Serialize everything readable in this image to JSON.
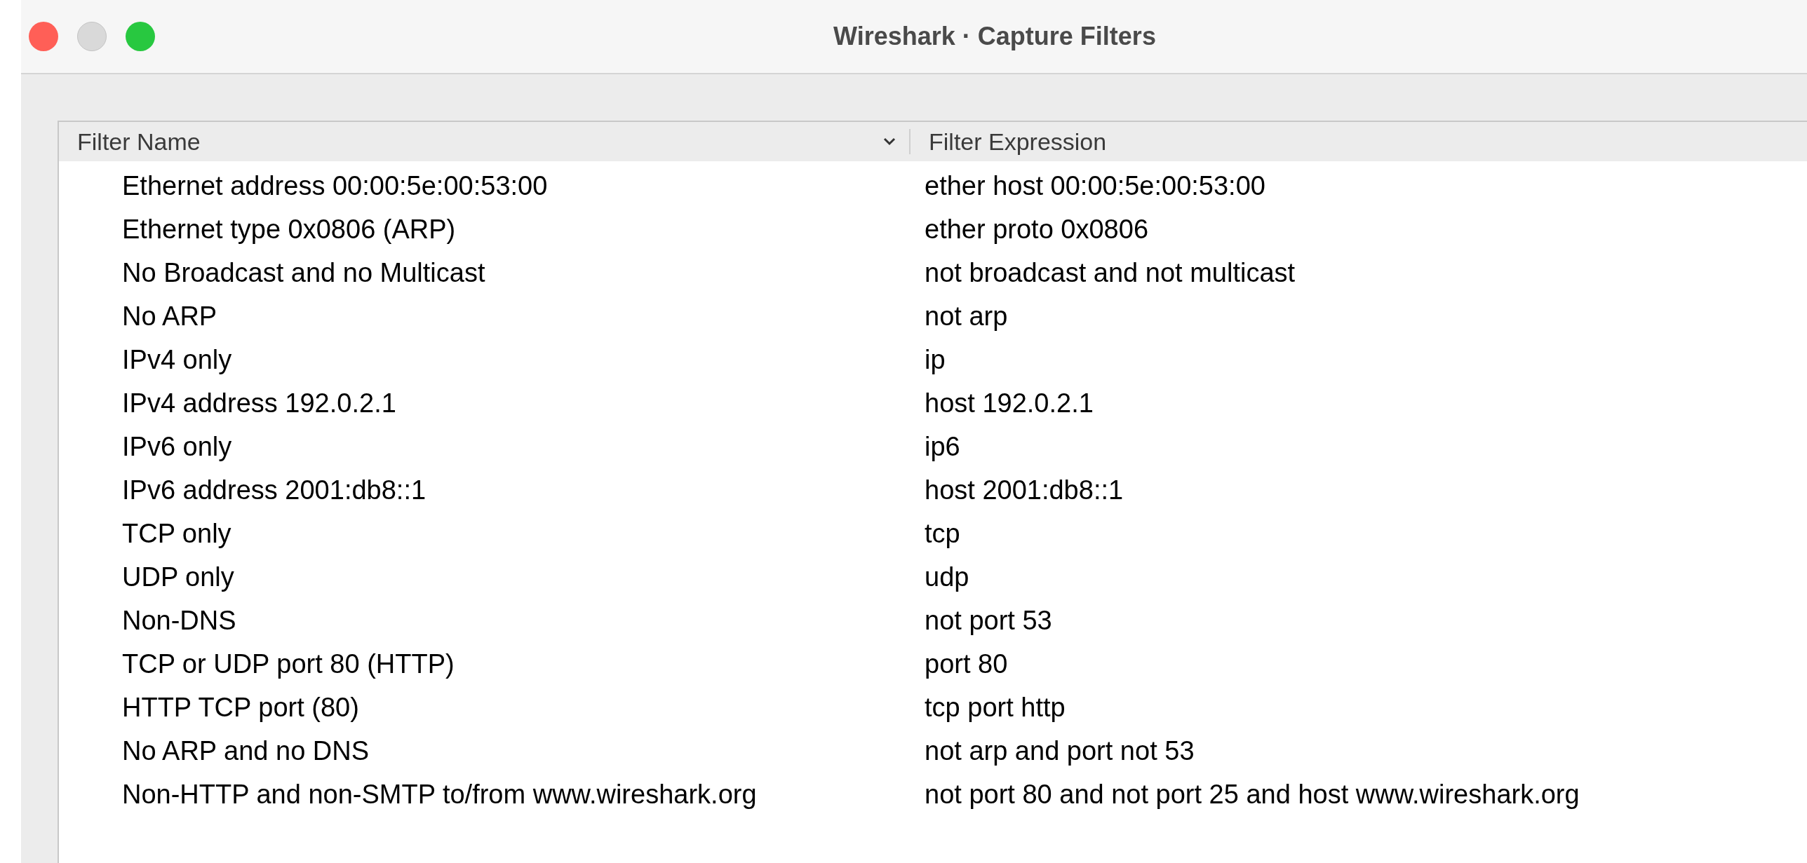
{
  "window": {
    "title": "Wireshark · Capture Filters"
  },
  "table": {
    "columns": [
      {
        "label": "Filter Name",
        "sorted": true
      },
      {
        "label": "Filter Expression",
        "sorted": false
      }
    ],
    "rows": [
      {
        "name": "Ethernet address 00:00:5e:00:53:00",
        "expression": "ether host 00:00:5e:00:53:00"
      },
      {
        "name": "Ethernet type 0x0806 (ARP)",
        "expression": "ether proto 0x0806"
      },
      {
        "name": "No Broadcast and no Multicast",
        "expression": "not broadcast and not multicast"
      },
      {
        "name": "No ARP",
        "expression": "not arp"
      },
      {
        "name": "IPv4 only",
        "expression": "ip"
      },
      {
        "name": "IPv4 address 192.0.2.1",
        "expression": "host 192.0.2.1"
      },
      {
        "name": "IPv6 only",
        "expression": "ip6"
      },
      {
        "name": "IPv6 address 2001:db8::1",
        "expression": "host 2001:db8::1"
      },
      {
        "name": "TCP only",
        "expression": "tcp"
      },
      {
        "name": "UDP only",
        "expression": "udp"
      },
      {
        "name": "Non-DNS",
        "expression": "not port 53"
      },
      {
        "name": "TCP or UDP port 80 (HTTP)",
        "expression": "port 80"
      },
      {
        "name": "HTTP TCP port (80)",
        "expression": "tcp port http"
      },
      {
        "name": "No ARP and no DNS",
        "expression": "not arp and port not 53"
      },
      {
        "name": "Non-HTTP and non-SMTP to/from www.wireshark.org",
        "expression": "not port 80 and not port 25 and host www.wireshark.org"
      }
    ]
  }
}
